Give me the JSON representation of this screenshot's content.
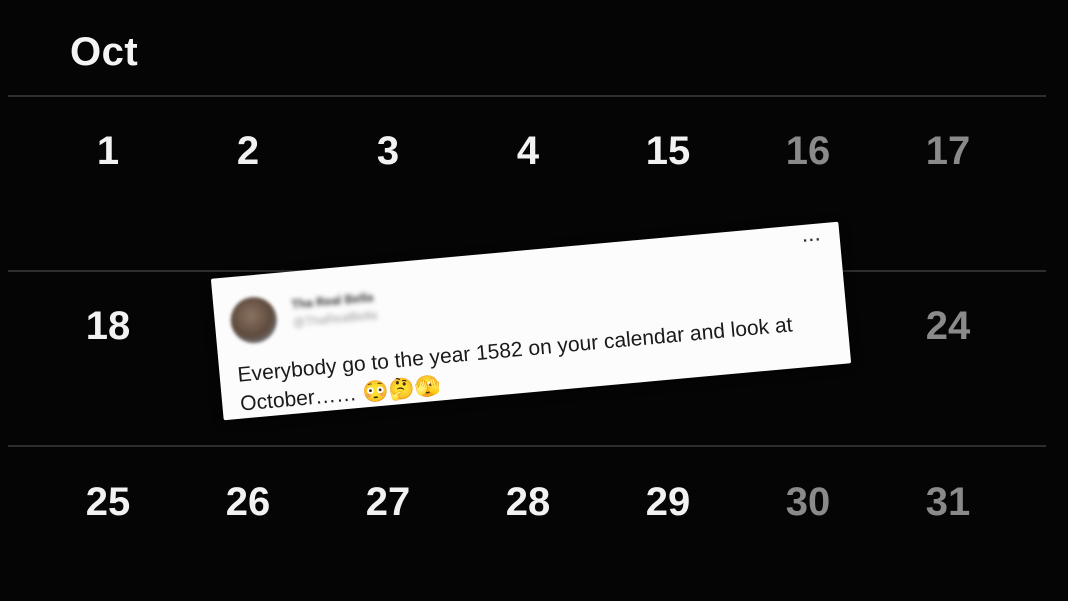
{
  "calendar": {
    "month": "Oct",
    "rows": [
      [
        {
          "day": "1",
          "dim": false
        },
        {
          "day": "2",
          "dim": false
        },
        {
          "day": "3",
          "dim": false
        },
        {
          "day": "4",
          "dim": false
        },
        {
          "day": "15",
          "dim": false
        },
        {
          "day": "16",
          "dim": true
        },
        {
          "day": "17",
          "dim": true
        }
      ],
      [
        {
          "day": "18",
          "dim": false
        },
        {
          "day": "",
          "dim": false
        },
        {
          "day": "",
          "dim": false
        },
        {
          "day": "",
          "dim": false
        },
        {
          "day": "",
          "dim": false
        },
        {
          "day": "",
          "dim": true
        },
        {
          "day": "24",
          "dim": true
        }
      ],
      [
        {
          "day": "25",
          "dim": false
        },
        {
          "day": "26",
          "dim": false
        },
        {
          "day": "27",
          "dim": false
        },
        {
          "day": "28",
          "dim": false
        },
        {
          "day": "29",
          "dim": false
        },
        {
          "day": "30",
          "dim": true
        },
        {
          "day": "31",
          "dim": true
        }
      ]
    ]
  },
  "tweet": {
    "author_name": "Tha Real Bella",
    "author_handle": "@ThaRealBella",
    "text": "Everybody go to the year 1582 on your calendar and look at October…… 😳🤔🫣",
    "more_icon": "···"
  },
  "colors": {
    "background": "#050505",
    "day_text": "#f2f2f2",
    "weekend_text": "#8a8a8a",
    "card": "#fcfcfc"
  }
}
